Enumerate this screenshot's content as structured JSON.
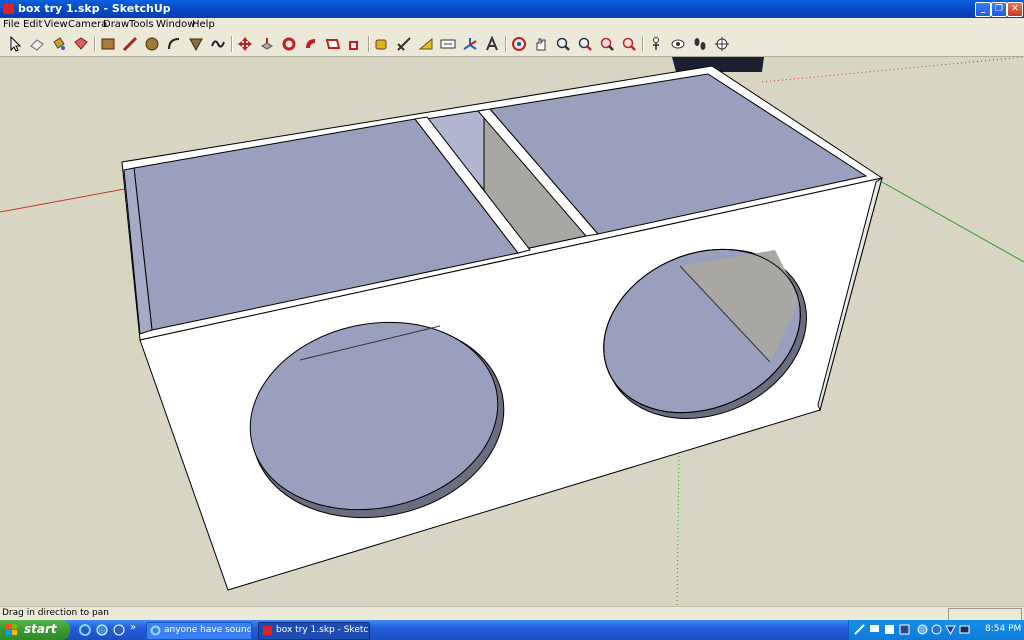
{
  "window": {
    "title": "box try 1.skp - SketchUp",
    "minimize": "_",
    "restore": "❐",
    "close": "✕"
  },
  "menu": [
    {
      "label": "File"
    },
    {
      "label": "Edit"
    },
    {
      "label": "View"
    },
    {
      "label": "Camera"
    },
    {
      "label": "Draw"
    },
    {
      "label": "Tools"
    },
    {
      "label": "Window"
    },
    {
      "label": "Help"
    }
  ],
  "toolbar": {
    "tools": [
      "select-icon",
      "eraser-icon",
      "paint-bucket-icon",
      "component-icon",
      "rectangle-icon",
      "line-icon",
      "circle-icon",
      "arc-icon",
      "polygon-icon",
      "freehand-icon",
      "move-icon",
      "push-pull-icon",
      "rotate-icon",
      "follow-me-icon",
      "offset-icon",
      "scale-icon",
      "tape-measure-icon",
      "dimension-icon",
      "protractor-icon",
      "text-icon",
      "axes-icon",
      "3d-text-icon",
      "orbit-icon",
      "pan-icon",
      "zoom-icon",
      "zoom-window-icon",
      "zoom-extents-icon",
      "previous-view-icon",
      "position-camera-icon",
      "look-around-icon",
      "walk-icon",
      "section-plane-icon"
    ]
  },
  "colors": {
    "axis_red": "#c0392b",
    "axis_green": "#2e9e2e",
    "face_blue": "#9a9fbd",
    "face_white": "#ffffff",
    "ground": "#d8d5c2"
  },
  "status": {
    "text": "Drag in direction to pan"
  },
  "taskbar": {
    "start": "start",
    "more": "»",
    "tasks": [
      {
        "label": "anyone have sound s..."
      },
      {
        "label": "box try 1.skp - Sketc..."
      }
    ],
    "clock": "8:54 PM"
  }
}
